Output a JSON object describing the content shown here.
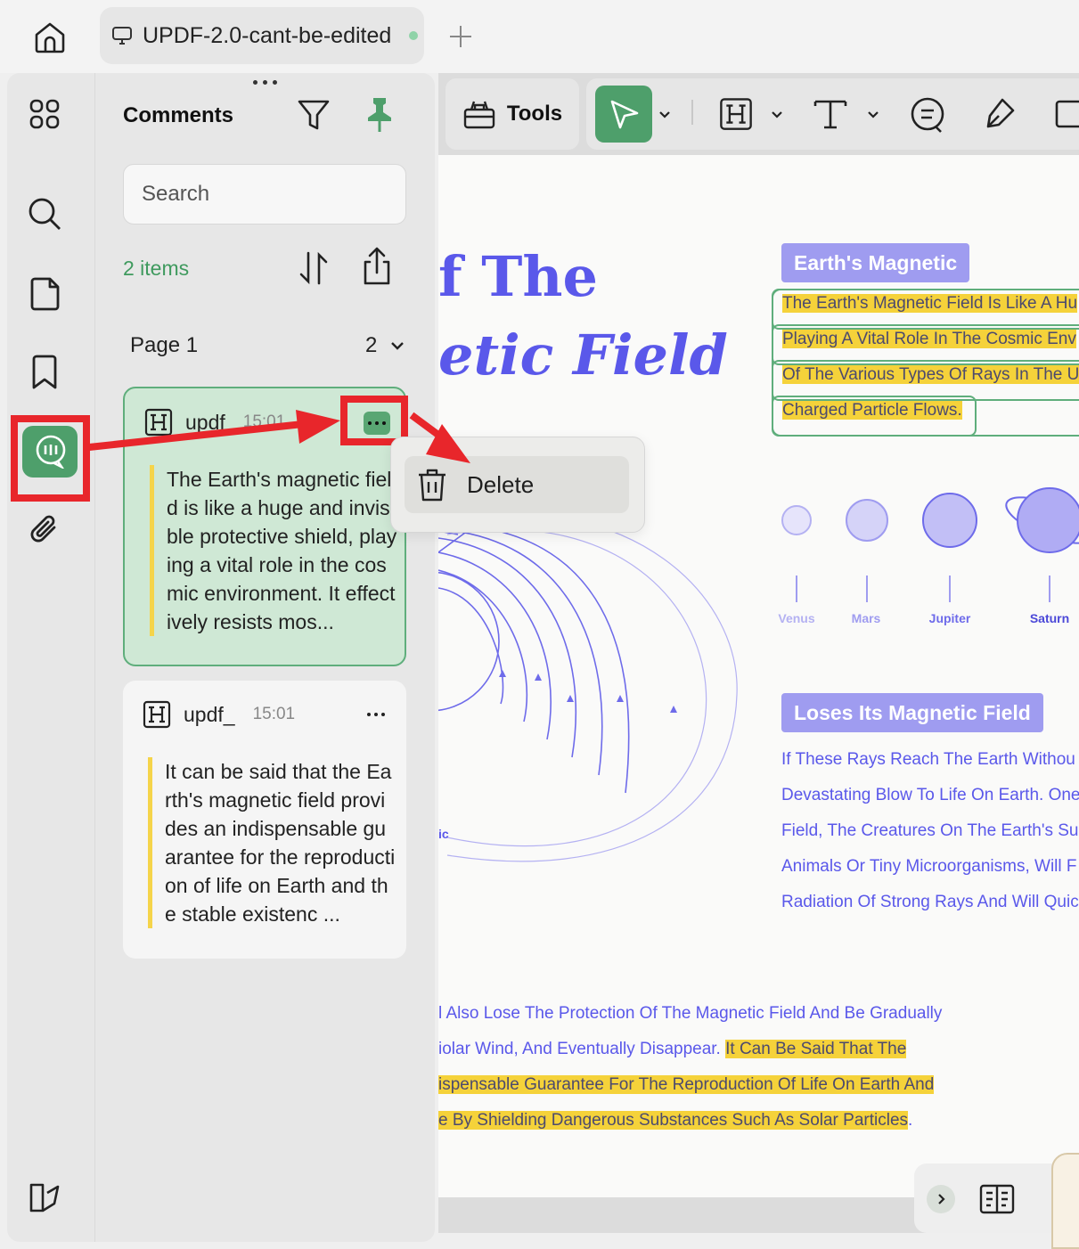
{
  "tab": {
    "title": "UPDF-2.0-cant-be-edited"
  },
  "panel": {
    "title": "Comments",
    "search_placeholder": "Search",
    "items_count": "2 items",
    "page_label": "Page 1",
    "page_count": "2"
  },
  "comments": [
    {
      "author": "updf",
      "time": "15:01",
      "text": "The Earth's magnetic field is like a huge and invisible protective shield, playing a vital role in the cosmic environment. It effectively resists mos..."
    },
    {
      "author": "updf_",
      "time": "15:01",
      "text": "It can be said that the Earth's magnetic field provides an indispensable guarantee for the reproduction of life on Earth and the stable existenc ..."
    }
  ],
  "context_menu": {
    "delete_label": "Delete"
  },
  "toolbar": {
    "tools_label": "Tools"
  },
  "document": {
    "title_line1": "f The",
    "title_line2": "etic Field",
    "section1_heading": "Earth's Magnetic",
    "section1_highlights": [
      "The Earth's Magnetic Field Is Like A Hu",
      "Playing A Vital Role In The Cosmic Env",
      "Of The Various Types Of Rays In The U",
      "Charged Particle Flows."
    ],
    "planets": [
      "Venus",
      "Mars",
      "Jupiter",
      "Saturn"
    ],
    "diagram_fragment": "ic",
    "section2_heading": "Loses Its Magnetic Field",
    "section2_lines": [
      "If These Rays Reach The Earth Withou",
      "Devastating Blow To Life On Earth. One",
      "Field, The Creatures On The Earth's Su",
      "Animals Or Tiny Microorganisms, Will F",
      "Radiation Of Strong Rays And Will Quic"
    ],
    "footer": {
      "line1": "l Also Lose The Protection Of The Magnetic Field And Be Gradually",
      "line2_plain": "iolar Wind, And Eventually Disappear. ",
      "line2_hl": "It Can Be Said That The",
      "line3_hl": "ispensable Guarantee For The Reproduction Of Life On Earth And",
      "line4_hl": "e By Shielding Dangerous Substances Such As Solar Particles",
      "line4_end": "."
    }
  },
  "colors": {
    "accent_green": "#4e9f6b",
    "annotation_red": "#e8262b",
    "highlight_yellow": "#f5d23a",
    "doc_purple": "#5a58ea"
  }
}
